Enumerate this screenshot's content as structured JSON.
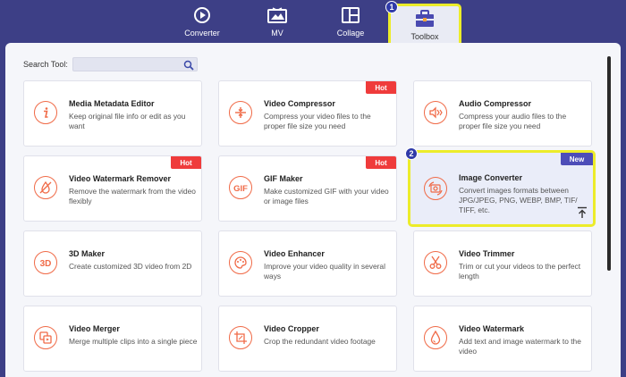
{
  "nav": {
    "tabs": [
      {
        "label": "Converter",
        "icon": "converter-icon"
      },
      {
        "label": "MV",
        "icon": "mv-icon"
      },
      {
        "label": "Collage",
        "icon": "collage-icon"
      },
      {
        "label": "Toolbox",
        "icon": "toolbox-icon"
      }
    ],
    "active": "Toolbox"
  },
  "badges": [
    "1",
    "2"
  ],
  "search": {
    "label": "Search Tool:",
    "value": "",
    "placeholder": ""
  },
  "colors": {
    "background": "#3d3f86",
    "accent": "#f06a47",
    "hot": "#ef3b3b",
    "new": "#4d4db8",
    "highlight": "#ecec2a"
  },
  "tools": [
    {
      "title": "Media Metadata Editor",
      "desc": "Keep original file info or edit as you want",
      "tag": "",
      "icon": "info-icon"
    },
    {
      "title": "Video Compressor",
      "desc": "Compress your video files to the proper file size you need",
      "tag": "Hot",
      "icon": "compress-icon"
    },
    {
      "title": "Audio Compressor",
      "desc": "Compress your audio files to the proper file size you need",
      "tag": "",
      "icon": "audio-compress-icon"
    },
    {
      "title": "Video Watermark Remover",
      "desc": "Remove the watermark from the video flexibly",
      "tag": "Hot",
      "icon": "watermark-remove-icon"
    },
    {
      "title": "GIF Maker",
      "desc": "Make customized GIF with your video or image files",
      "tag": "Hot",
      "icon": "gif-icon"
    },
    {
      "title": "Image Converter",
      "desc": "Convert images formats between JPG/JPEG, PNG, WEBP, BMP, TIF/ TIFF, etc.",
      "tag": "New",
      "icon": "image-convert-icon"
    },
    {
      "title": "3D Maker",
      "desc": "Create customized 3D video from 2D",
      "tag": "",
      "icon": "3d-icon"
    },
    {
      "title": "Video Enhancer",
      "desc": "Improve your video quality in several ways",
      "tag": "",
      "icon": "palette-icon"
    },
    {
      "title": "Video Trimmer",
      "desc": "Trim or cut your videos to the perfect length",
      "tag": "",
      "icon": "scissors-icon"
    },
    {
      "title": "Video Merger",
      "desc": "Merge multiple clips into a single piece",
      "tag": "",
      "icon": "merge-icon"
    },
    {
      "title": "Video Cropper",
      "desc": "Crop the redundant video footage",
      "tag": "",
      "icon": "crop-icon"
    },
    {
      "title": "Video Watermark",
      "desc": "Add text and image watermark to the video",
      "tag": "",
      "icon": "droplet-icon"
    }
  ]
}
